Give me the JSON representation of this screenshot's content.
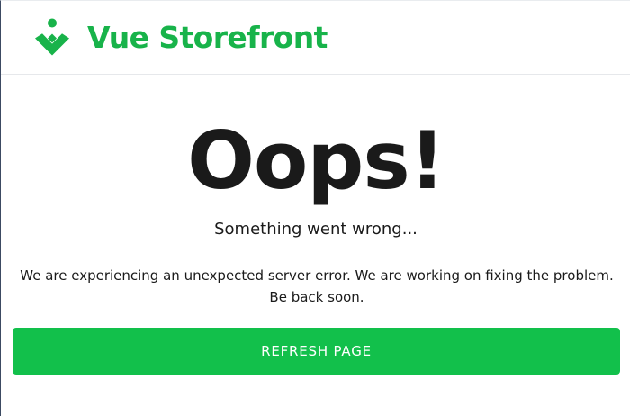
{
  "header": {
    "logo_text": "Vue Storefront",
    "logo_icon": "vue-storefront-logo-icon",
    "brand_color": "#18b34a"
  },
  "error": {
    "title": "Oops!",
    "subtitle": "Something went wrong...",
    "message": "We are experiencing an unexpected server error. We are working on fixing the problem. Be back soon.",
    "button_label": "REFRESH PAGE",
    "button_color": "#12c04b"
  }
}
